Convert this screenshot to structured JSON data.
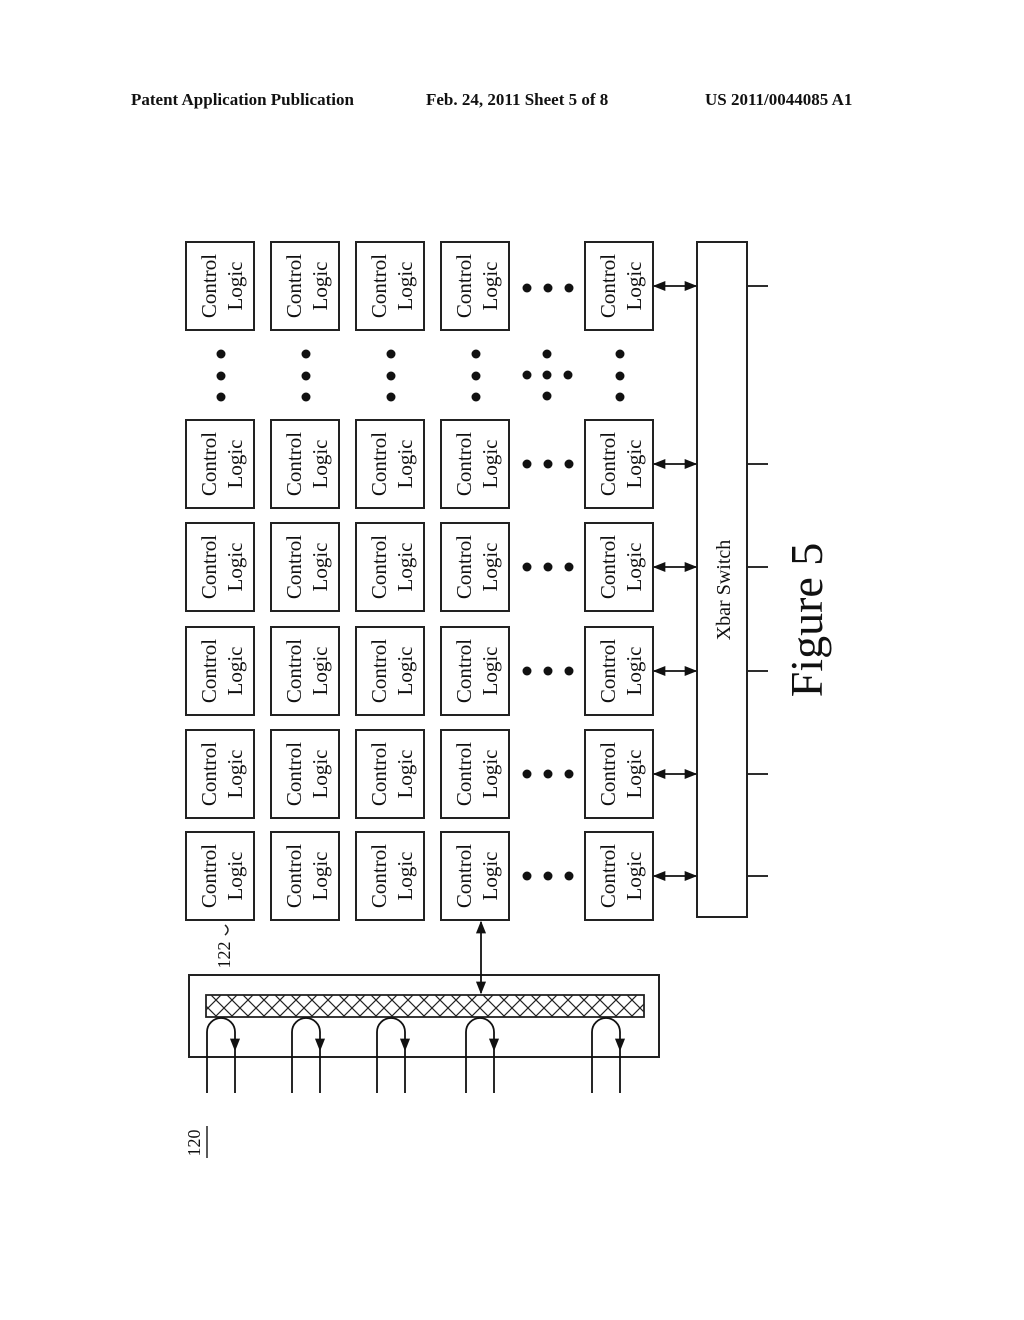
{
  "header": {
    "left": "Patent Application Publication",
    "middle": "Feb. 24, 2011   Sheet 5 of 8",
    "right": "US 2011/0044085 A1"
  },
  "figure": {
    "caption": "Figure 5",
    "reference_numeral_system": "120",
    "reference_numeral_control_logic": "122",
    "xbar_label": "Xbar Switch",
    "block_line1": "Control",
    "block_line2": "Logic",
    "grid": {
      "visible_rows": 6,
      "visible_columns": 5,
      "ellipsis_between_last_columns": true,
      "ellipsis_between_first_and_second_row": true
    },
    "port_loops_visible": 5
  }
}
